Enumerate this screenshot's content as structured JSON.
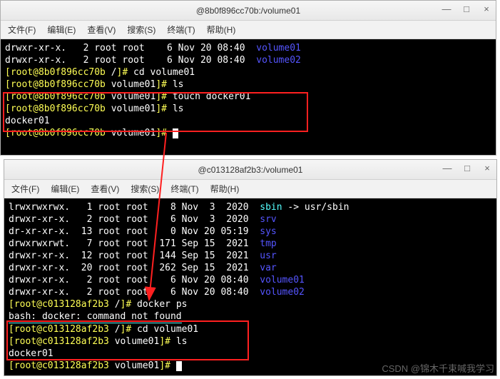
{
  "win1": {
    "title": "@8b0f896cc70b:/volume01",
    "menu": [
      "文件(F)",
      "编辑(E)",
      "查看(V)",
      "搜索(S)",
      "终端(T)",
      "帮助(H)"
    ],
    "lines": {
      "l0_perm": "drwxr-xr-x.",
      "l0_n": "2",
      "l0_u": "root",
      "l0_g": "root",
      "l0_sz": "6",
      "l0_m": "Nov",
      "l0_d": "20",
      "l0_t": "08:40",
      "l0_name": "volume01",
      "l1_perm": "drwxr-xr-x.",
      "l1_n": "2",
      "l1_u": "root",
      "l1_g": "root",
      "l1_sz": "6",
      "l1_m": "Nov",
      "l1_d": "20",
      "l1_t": "08:40",
      "l1_name": "volume02",
      "p1_open": "[",
      "p1_user": "root@8b0f896cc70b",
      "p1_path": " /",
      "p1_close": "]# ",
      "p1_cmd": "cd volume01",
      "p2_open": "[",
      "p2_user": "root@8b0f896cc70b",
      "p2_path": " volume01",
      "p2_close": "]# ",
      "p2_cmd": "ls",
      "p3_open": "[",
      "p3_user": "root@8b0f896cc70b",
      "p3_path": " volume01",
      "p3_close": "]# ",
      "p3_cmd": "touch docker01",
      "p4_open": "[",
      "p4_user": "root@8b0f896cc70b",
      "p4_path": " volume01",
      "p4_close": "]# ",
      "p4_cmd": "ls",
      "out1": "docker01",
      "p5_open": "[",
      "p5_user": "root@8b0f896cc70b",
      "p5_path": " volume01",
      "p5_close": "]# "
    }
  },
  "win2": {
    "title": "@c013128af2b3:/volume01",
    "menu": [
      "文件(F)",
      "编辑(E)",
      "查看(V)",
      "搜索(S)",
      "终端(T)",
      "帮助(H)"
    ],
    "lines": {
      "r0_perm": "lrwxrwxrwx.",
      "r0_n": "1",
      "r0_u": "root",
      "r0_g": "root",
      "r0_sz": "8",
      "r0_m": "Nov",
      "r0_d": " 3",
      "r0_t": " 2020",
      "r0_name": "sbin",
      "r0_arrow": " -> usr/sbin",
      "r1_perm": "drwxr-xr-x.",
      "r1_n": "2",
      "r1_u": "root",
      "r1_g": "root",
      "r1_sz": "6",
      "r1_m": "Nov",
      "r1_d": " 3",
      "r1_t": " 2020",
      "r1_name": "srv",
      "r2_perm": "dr-xr-xr-x.",
      "r2_n": "13",
      "r2_u": "root",
      "r2_g": "root",
      "r2_sz": "0",
      "r2_m": "Nov",
      "r2_d": "20",
      "r2_t": "05:19",
      "r2_name": "sys",
      "r3_perm": "drwxrwxrwt.",
      "r3_n": "7",
      "r3_u": "root",
      "r3_g": "root",
      "r3_sz": "171",
      "r3_m": "Sep",
      "r3_d": "15",
      "r3_t": " 2021",
      "r3_name": "tmp",
      "r4_perm": "drwxr-xr-x.",
      "r4_n": "12",
      "r4_u": "root",
      "r4_g": "root",
      "r4_sz": "144",
      "r4_m": "Sep",
      "r4_d": "15",
      "r4_t": " 2021",
      "r4_name": "usr",
      "r5_perm": "drwxr-xr-x.",
      "r5_n": "20",
      "r5_u": "root",
      "r5_g": "root",
      "r5_sz": "262",
      "r5_m": "Sep",
      "r5_d": "15",
      "r5_t": " 2021",
      "r5_name": "var",
      "r6_perm": "drwxr-xr-x.",
      "r6_n": "2",
      "r6_u": "root",
      "r6_g": "root",
      "r6_sz": "6",
      "r6_m": "Nov",
      "r6_d": "20",
      "r6_t": "08:40",
      "r6_name": "volume01",
      "r7_perm": "drwxr-xr-x.",
      "r7_n": "2",
      "r7_u": "root",
      "r7_g": "root",
      "r7_sz": "6",
      "r7_m": "Nov",
      "r7_d": "20",
      "r7_t": "08:40",
      "r7_name": "volume02",
      "q1_open": "[",
      "q1_user": "root@c013128af2b3",
      "q1_path": " /",
      "q1_close": "]# ",
      "q1_cmd": "docker ps",
      "err": "bash: docker: command not found",
      "q2_open": "[",
      "q2_user": "root@c013128af2b3",
      "q2_path": " /",
      "q2_close": "]# ",
      "q2_cmd": "cd volume01",
      "q3_open": "[",
      "q3_user": "root@c013128af2b3",
      "q3_path": " volume01",
      "q3_close": "]# ",
      "q3_cmd": "ls",
      "out1": "docker01",
      "q4_open": "[",
      "q4_user": "root@c013128af2b3",
      "q4_path": " volume01",
      "q4_close": "]# "
    }
  },
  "watermark": "CSDN @锦木千束喊我学习",
  "ctrls": {
    "min": "—",
    "max": "□",
    "close": "×"
  }
}
